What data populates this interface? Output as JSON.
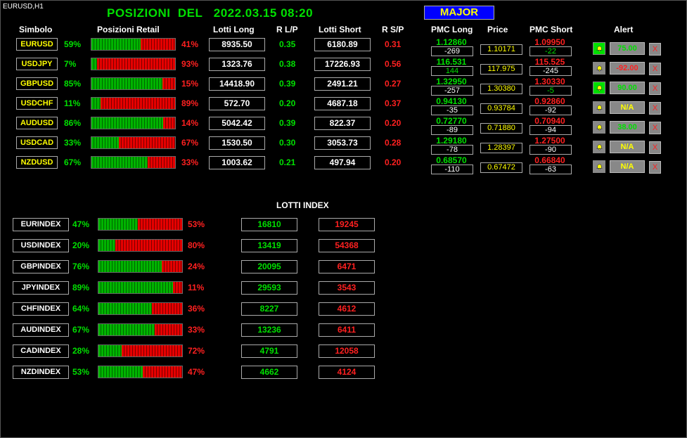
{
  "chart_label": "EURUSD,H1",
  "title": "POSIZIONI  DEL   2022.03.15 08:20",
  "major_label": "MAJOR",
  "headers": {
    "simbolo": "Simbolo",
    "posizioni": "Posizioni Retail",
    "lotti_long": "Lotti Long",
    "rlp": "R L/P",
    "lotti_short": "Lotti Short",
    "rsp": "R S/P",
    "pmc_long": "PMC Long",
    "price": "Price",
    "pmc_short": "PMC Short",
    "alert": "Alert"
  },
  "pairs": [
    {
      "symbol": "EURUSD",
      "long_pct": "59%",
      "long_frac": 0.59,
      "short_pct": "41%",
      "lotti_long": "8935.50",
      "rlp": "0.35",
      "lotti_short": "6180.89",
      "rsp": "0.31",
      "pmc_long": "1.12860",
      "pmc_long_diff": "-269",
      "pmc_long_diff_color": "#ffffff",
      "price": "1.10171",
      "pmc_short": "1.09950",
      "pmc_short_diff": "-22",
      "pmc_short_diff_color": "#00e000",
      "bell_on": true,
      "alert_value": "75.00",
      "alert_color": "#00e000",
      "x_label": "X"
    },
    {
      "symbol": "USDJPY",
      "long_pct": "7%",
      "long_frac": 0.07,
      "short_pct": "93%",
      "lotti_long": "1323.76",
      "rlp": "0.38",
      "lotti_short": "17226.93",
      "rsp": "0.56",
      "pmc_long": "116.531",
      "pmc_long_diff": "144",
      "pmc_long_diff_color": "#00e000",
      "price": "117.975",
      "pmc_short": "115.525",
      "pmc_short_diff": "-245",
      "pmc_short_diff_color": "#ffffff",
      "bell_on": false,
      "alert_value": "-92.00",
      "alert_color": "#ff2020",
      "x_label": "X"
    },
    {
      "symbol": "GBPUSD",
      "long_pct": "85%",
      "long_frac": 0.85,
      "short_pct": "15%",
      "lotti_long": "14418.90",
      "rlp": "0.39",
      "lotti_short": "2491.21",
      "rsp": "0.27",
      "pmc_long": "1.32950",
      "pmc_long_diff": "-257",
      "pmc_long_diff_color": "#ffffff",
      "price": "1.30380",
      "pmc_short": "1.30330",
      "pmc_short_diff": "-5",
      "pmc_short_diff_color": "#00e000",
      "bell_on": true,
      "alert_value": "90.00",
      "alert_color": "#00e000",
      "x_label": "X"
    },
    {
      "symbol": "USDCHF",
      "long_pct": "11%",
      "long_frac": 0.11,
      "short_pct": "89%",
      "lotti_long": "572.70",
      "rlp": "0.20",
      "lotti_short": "4687.18",
      "rsp": "0.37",
      "pmc_long": "0.94130",
      "pmc_long_diff": "-35",
      "pmc_long_diff_color": "#ffffff",
      "price": "0.93784",
      "pmc_short": "0.92860",
      "pmc_short_diff": "-92",
      "pmc_short_diff_color": "#ffffff",
      "bell_on": false,
      "alert_value": "N/A",
      "alert_color": "#ffff00",
      "x_label": "X"
    },
    {
      "symbol": "AUDUSD",
      "long_pct": "86%",
      "long_frac": 0.86,
      "short_pct": "14%",
      "lotti_long": "5042.42",
      "rlp": "0.39",
      "lotti_short": "822.37",
      "rsp": "0.20",
      "pmc_long": "0.72770",
      "pmc_long_diff": "-89",
      "pmc_long_diff_color": "#ffffff",
      "price": "0.71880",
      "pmc_short": "0.70940",
      "pmc_short_diff": "-94",
      "pmc_short_diff_color": "#ffffff",
      "bell_on": false,
      "alert_value": "38.00",
      "alert_color": "#00e000",
      "x_label": "X"
    },
    {
      "symbol": "USDCAD",
      "long_pct": "33%",
      "long_frac": 0.33,
      "short_pct": "67%",
      "lotti_long": "1530.50",
      "rlp": "0.30",
      "lotti_short": "3053.73",
      "rsp": "0.28",
      "pmc_long": "1.29180",
      "pmc_long_diff": "-78",
      "pmc_long_diff_color": "#ffffff",
      "price": "1.28397",
      "pmc_short": "1.27500",
      "pmc_short_diff": "-90",
      "pmc_short_diff_color": "#ffffff",
      "bell_on": false,
      "alert_value": "N/A",
      "alert_color": "#ffff00",
      "x_label": "X"
    },
    {
      "symbol": "NZDUSD",
      "long_pct": "67%",
      "long_frac": 0.67,
      "short_pct": "33%",
      "lotti_long": "1003.62",
      "rlp": "0.21",
      "lotti_short": "497.94",
      "rsp": "0.20",
      "pmc_long": "0.68570",
      "pmc_long_diff": "-110",
      "pmc_long_diff_color": "#ffffff",
      "price": "0.67472",
      "pmc_short": "0.66840",
      "pmc_short_diff": "-63",
      "pmc_short_diff_color": "#ffffff",
      "bell_on": false,
      "alert_value": "N/A",
      "alert_color": "#ffff00",
      "x_label": "X"
    }
  ],
  "index_title": "LOTTI INDEX",
  "indexes": [
    {
      "name": "EURINDEX",
      "long_pct": "47%",
      "long_frac": 0.47,
      "short_pct": "53%",
      "long_lots": "16810",
      "short_lots": "19245"
    },
    {
      "name": "USDINDEX",
      "long_pct": "20%",
      "long_frac": 0.2,
      "short_pct": "80%",
      "long_lots": "13419",
      "short_lots": "54368"
    },
    {
      "name": "GBPINDEX",
      "long_pct": "76%",
      "long_frac": 0.76,
      "short_pct": "24%",
      "long_lots": "20095",
      "short_lots": "6471"
    },
    {
      "name": "JPYINDEX",
      "long_pct": "89%",
      "long_frac": 0.89,
      "short_pct": "11%",
      "long_lots": "29593",
      "short_lots": "3543"
    },
    {
      "name": "CHFINDEX",
      "long_pct": "64%",
      "long_frac": 0.64,
      "short_pct": "36%",
      "long_lots": "8227",
      "short_lots": "4612"
    },
    {
      "name": "AUDINDEX",
      "long_pct": "67%",
      "long_frac": 0.67,
      "short_pct": "33%",
      "long_lots": "13236",
      "short_lots": "6411"
    },
    {
      "name": "CADINDEX",
      "long_pct": "28%",
      "long_frac": 0.28,
      "short_pct": "72%",
      "long_lots": "4791",
      "short_lots": "12058"
    },
    {
      "name": "NZDINDEX",
      "long_pct": "53%",
      "long_frac": 0.53,
      "short_pct": "47%",
      "long_lots": "4662",
      "short_lots": "4124"
    }
  ],
  "colors": {
    "green": "#00e000",
    "red": "#ff2020",
    "yellow": "#ffff00",
    "major_bg": "#0000ff"
  },
  "icons": {
    "bell": "bell-icon",
    "close": "close-icon"
  }
}
